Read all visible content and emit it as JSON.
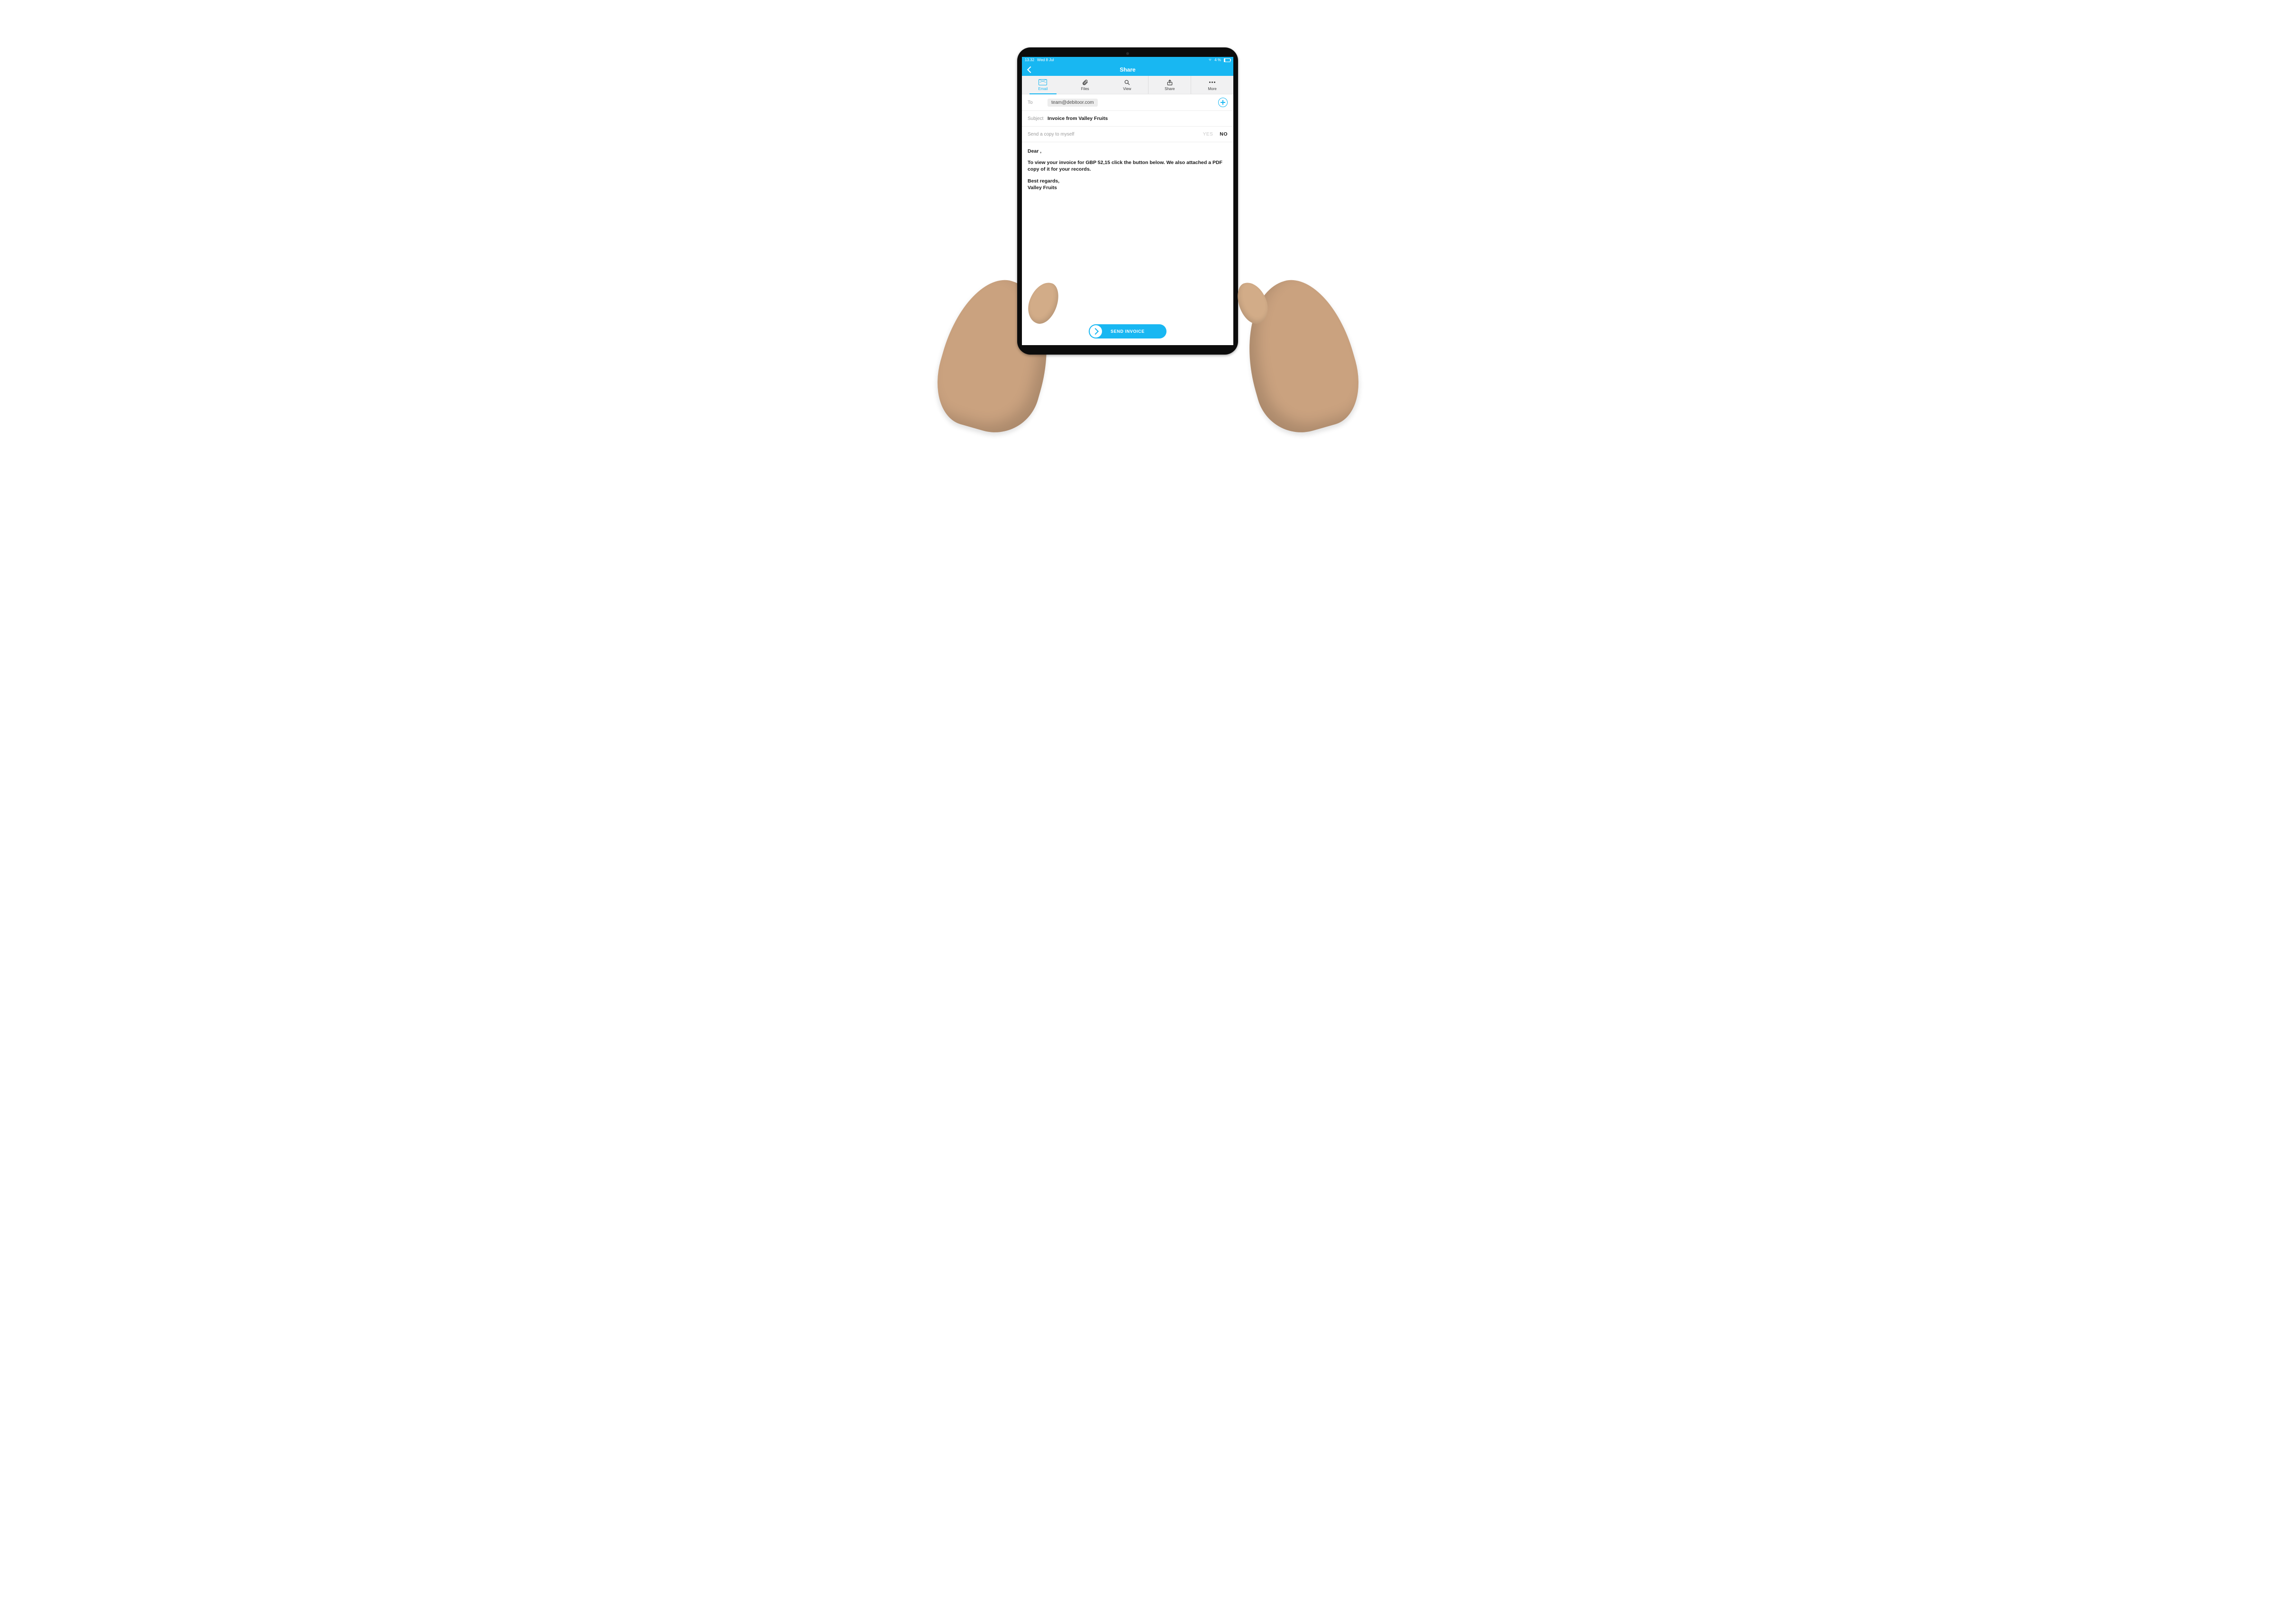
{
  "statusbar": {
    "time": "13.32",
    "date": "Wed 8 Jul",
    "battery": "4 %"
  },
  "navbar": {
    "title": "Share"
  },
  "tabs": {
    "email": "Email",
    "files": "Files",
    "view": "View",
    "share": "Share",
    "more": "More"
  },
  "to": {
    "label": "To",
    "recipient": "team@debitoor.com"
  },
  "subject": {
    "label": "Subject",
    "value": "Invoice from Valley Fruits"
  },
  "copy": {
    "label": "Send a copy to myself",
    "yes": "YES",
    "no": "NO"
  },
  "body": {
    "greeting": "Dear ,",
    "line": "To view your invoice for GBP 52,15 click the button below. We also attached a PDF copy of it for your records.",
    "regards": "Best regards,",
    "company": "Valley Fruits"
  },
  "send": {
    "label": "SEND INVOICE"
  }
}
